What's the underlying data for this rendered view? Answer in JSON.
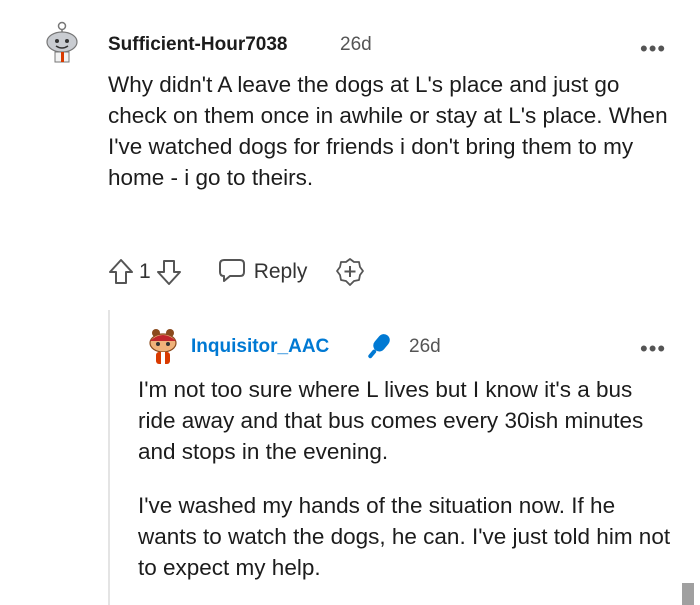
{
  "comment": {
    "author": "Sufficient-Hour7038",
    "time": "26d",
    "more_label": "•••",
    "body": "Why didn't A leave the dogs at L's place and just go check on them once in awhile or stay at L's place. When I've watched dogs for friends i don't bring them to my home - i go to theirs.",
    "vote_count": "1",
    "reply_label": "Reply"
  },
  "reply": {
    "author": "Inquisitor_AAC",
    "author_color": "#0079d3",
    "time": "26d",
    "more_label": "•••",
    "paragraph_1": "I'm not too sure where L lives but I know it's a bus ride away and that bus comes every 30ish minutes and stops in the evening.",
    "paragraph_2": "I've washed my hands of the situation now. If he wants to watch the dogs, he can. I've just told him not to expect my help."
  },
  "icons": {
    "upvote": "upvote-arrow-icon",
    "downvote": "downvote-arrow-icon",
    "reply": "speech-bubble-icon",
    "award": "award-plus-icon",
    "op_badge": "microphone-icon"
  }
}
